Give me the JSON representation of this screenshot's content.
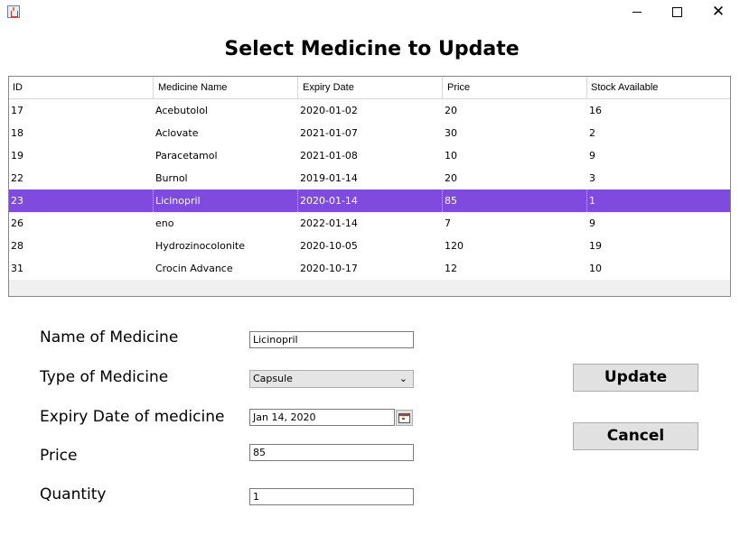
{
  "window": {
    "icon": "java-app-icon",
    "controls": {
      "minimize": "minimize-icon",
      "maximize": "maximize-icon",
      "close": "✕"
    }
  },
  "title": "Select Medicine to Update",
  "table": {
    "columns": [
      "ID",
      "Medicine Name",
      "Expiry Date",
      "Price",
      "Stock Available"
    ],
    "rows": [
      [
        "17",
        "Acebutolol",
        "2020-01-02",
        "20",
        "16"
      ],
      [
        "18",
        "Aclovate",
        "2021-01-07",
        "30",
        "2"
      ],
      [
        "19",
        "Paracetamol",
        "2021-01-08",
        "10",
        "9"
      ],
      [
        "22",
        "Burnol",
        "2019-01-14",
        "20",
        "3"
      ],
      [
        "23",
        "Licinopril",
        "2020-01-14",
        "85",
        "1"
      ],
      [
        "26",
        "eno",
        "2022-01-14",
        "7",
        "9"
      ],
      [
        "28",
        "Hydrozinocolonite",
        "2020-10-05",
        "120",
        "19"
      ],
      [
        "31",
        "Crocin Advance",
        "2020-10-17",
        "12",
        "10"
      ]
    ],
    "selected_row_index": 4,
    "selection_color": "#7f4bde"
  },
  "form": {
    "name_label": "Name of Medicine",
    "name_value": "Licinopril",
    "type_label": "Type of Medicine",
    "type_value": "Capsule",
    "expiry_label": "Expiry Date of medicine",
    "expiry_value": "Jan 14, 2020",
    "price_label": "Price",
    "price_value": "85",
    "quantity_label": "Quantity",
    "quantity_value": "1"
  },
  "buttons": {
    "update": "Update",
    "cancel": "Cancel"
  }
}
